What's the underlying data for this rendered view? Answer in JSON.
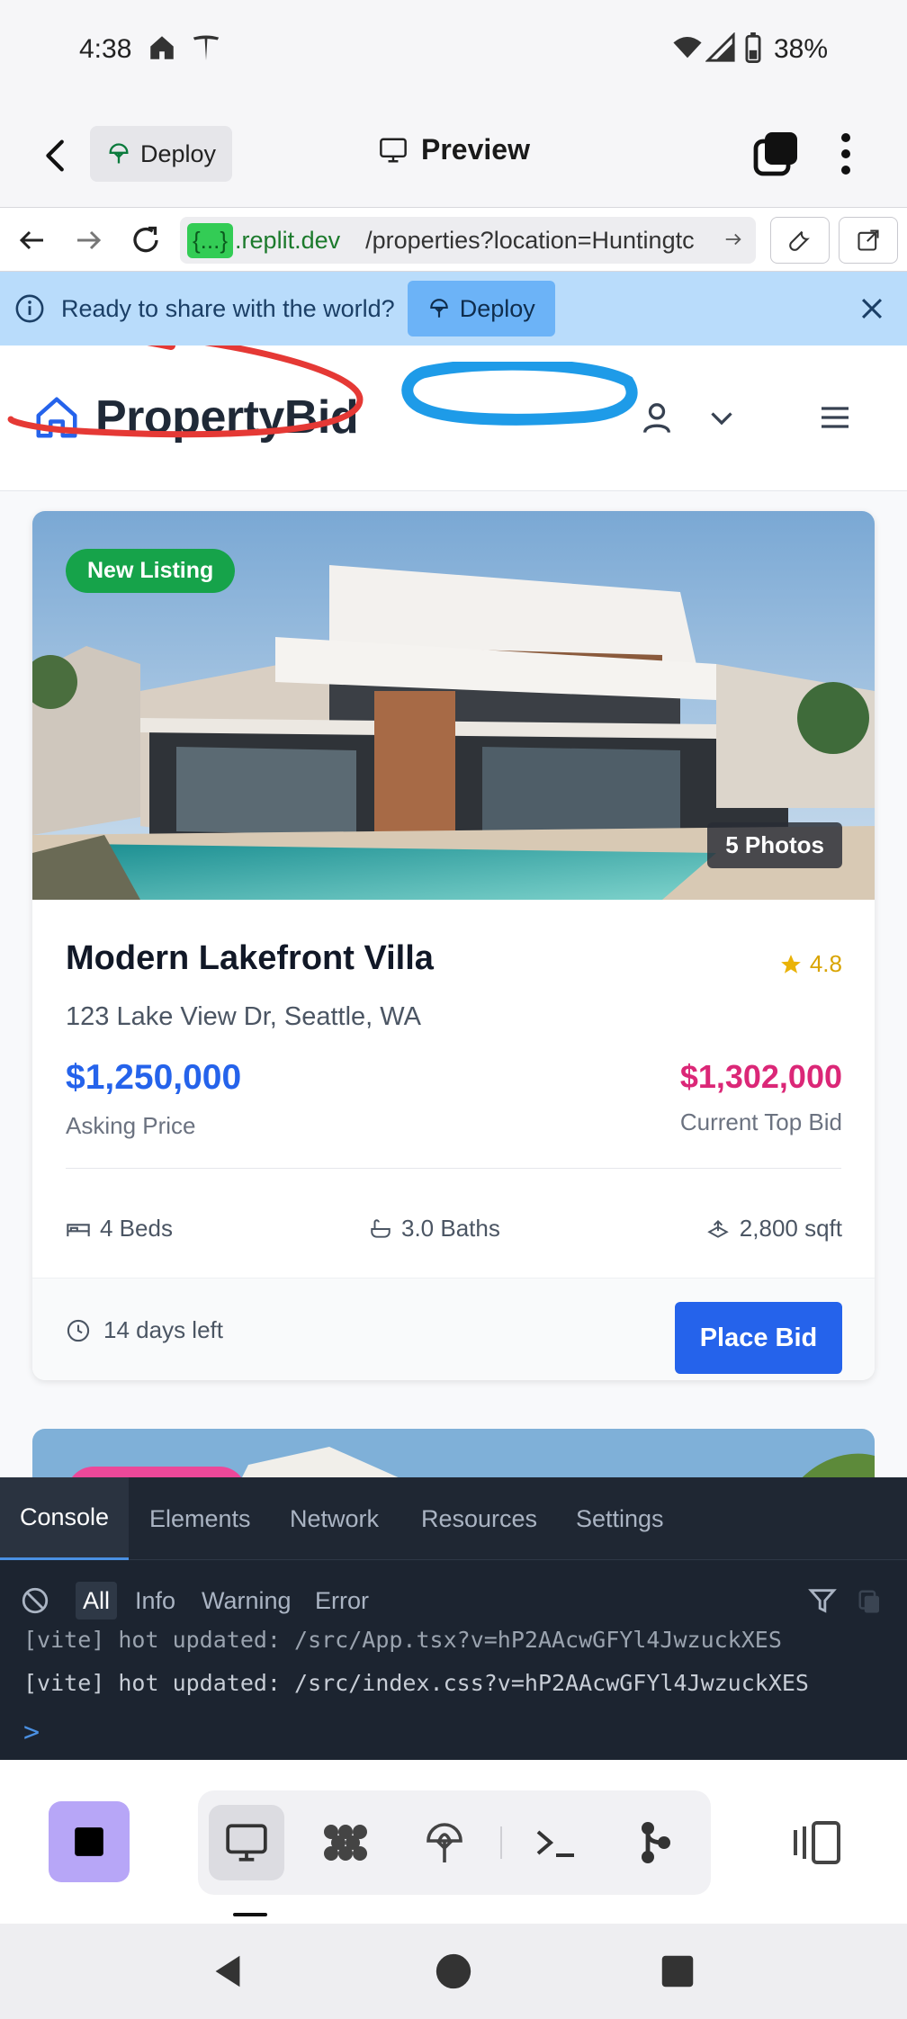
{
  "status_bar": {
    "time": "4:38",
    "battery": "38%"
  },
  "replit_header": {
    "deploy_label": "Deploy",
    "title": "Preview"
  },
  "url_bar": {
    "host_badge": "{...}",
    "host": ".replit.dev",
    "path": "/properties?location=Huntingtc"
  },
  "banner": {
    "message": "Ready to share with the world?",
    "deploy_label": "Deploy"
  },
  "app": {
    "brand": "PropertyBid"
  },
  "listing": {
    "badge": "New Listing",
    "photos": "5 Photos",
    "title": "Modern Lakefront Villa",
    "rating": "4.8",
    "address": "123 Lake View Dr, Seattle, WA",
    "asking_price": "$1,250,000",
    "asking_label": "Asking Price",
    "top_bid": "$1,302,000",
    "top_bid_label": "Current Top Bid",
    "beds": "4 Beds",
    "baths": "3.0 Baths",
    "sqft": "2,800 sqft",
    "days_left": "14 days left",
    "bid_button": "Place Bid"
  },
  "console": {
    "tabs": [
      "Console",
      "Elements",
      "Network",
      "Resources",
      "Settings"
    ],
    "filters": [
      "All",
      "Info",
      "Warning",
      "Error"
    ],
    "logs": [
      "[vite] hot updated: /src/App.tsx?v=hP2AAcwGFYl4JwzuckXES",
      "[vite] hot updated: /src/index.css?v=hP2AAcwGFYl4JwzuckXES"
    ],
    "prompt": ">"
  },
  "colors": {
    "primary": "#2563eb",
    "bid": "#db2777",
    "new_badge": "#16a34a",
    "banner": "#b9dcfb",
    "console_bg": "#1c2430"
  },
  "icons": [
    "home-icon",
    "arrow-left-icon",
    "arrow-right-icon",
    "reload-icon",
    "wrench-icon",
    "external-link-icon",
    "info-icon",
    "close-icon",
    "user-icon",
    "chevron-down-icon",
    "menu-icon",
    "star-icon",
    "bed-icon",
    "bath-icon",
    "area-icon",
    "clock-icon",
    "block-icon",
    "filter-icon",
    "copy-icon",
    "monitor-icon",
    "packages-icon",
    "deploy-icon",
    "terminal-icon",
    "git-icon",
    "layout-icon"
  ]
}
